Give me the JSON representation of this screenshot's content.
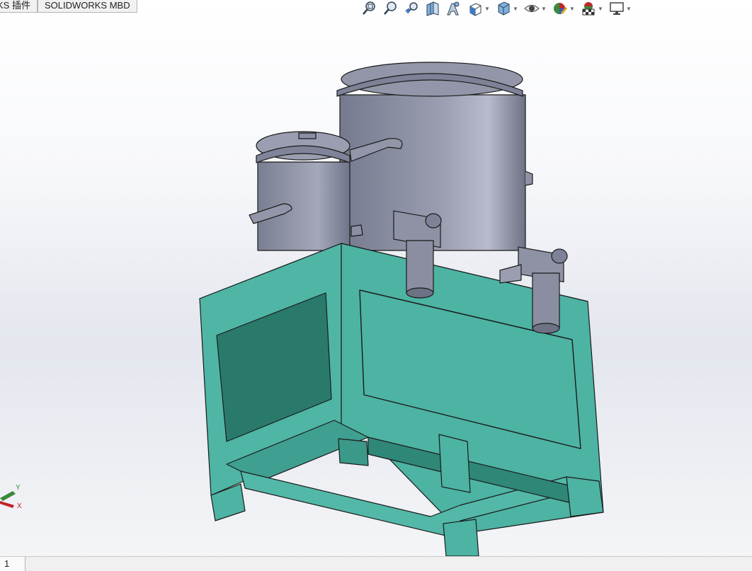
{
  "tabs": [
    {
      "label": "KS 插件"
    },
    {
      "label": "SOLIDWORKS MBD"
    }
  ],
  "toolbar": {
    "icons": [
      "zoom-to-fit-icon",
      "zoom-to-area-icon",
      "previous-view-icon",
      "section-view-icon",
      "dynamic-annotation-icon",
      "view-orientation-icon",
      "display-style-icon",
      "hide-show-items-icon",
      "edit-appearance-icon",
      "apply-scene-icon",
      "view-settings-icon"
    ]
  },
  "triad": {
    "y_label": "Y",
    "x_label": "X"
  },
  "status": {
    "tab_label": "1"
  },
  "colors": {
    "frame_light": "#4db3a3",
    "frame_dark": "#2a7a6c",
    "tank": "#8a8ea0",
    "accent_red": "#c0262a",
    "accent_green": "#3a8a3a"
  }
}
